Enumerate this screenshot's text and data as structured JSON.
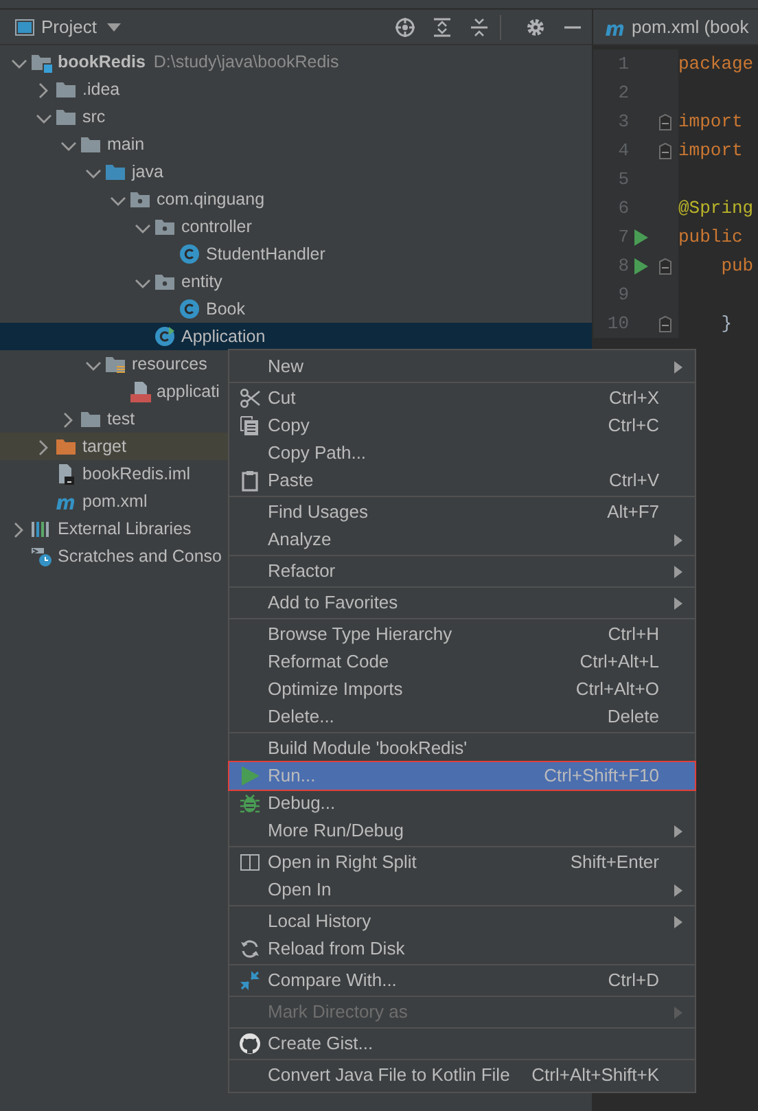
{
  "project_panel": {
    "title": "Project"
  },
  "tree": [
    {
      "label": "bookRedis",
      "path": "D:\\study\\java\\bookRedis",
      "kind": "module",
      "expanded": true,
      "selected": false,
      "children": [
        {
          "label": ".idea",
          "kind": "folder",
          "expanded": false,
          "selected": false
        },
        {
          "label": "src",
          "kind": "folder",
          "expanded": true,
          "selected": false,
          "children": [
            {
              "label": "main",
              "kind": "folder",
              "expanded": true,
              "selected": false,
              "children": [
                {
                  "label": "java",
                  "kind": "source",
                  "expanded": true,
                  "selected": false,
                  "children": [
                    {
                      "label": "com.qinguang",
                      "kind": "package",
                      "expanded": true,
                      "selected": false,
                      "children": [
                        {
                          "label": "controller",
                          "kind": "package",
                          "expanded": true,
                          "selected": false,
                          "children": [
                            {
                              "label": "StudentHandler",
                              "kind": "class",
                              "selected": false
                            }
                          ]
                        },
                        {
                          "label": "entity",
                          "kind": "package",
                          "expanded": true,
                          "selected": false,
                          "children": [
                            {
                              "label": "Book",
                              "kind": "class",
                              "selected": false
                            }
                          ]
                        },
                        {
                          "label": "Application",
                          "kind": "springclass",
                          "selected": true
                        }
                      ]
                    }
                  ]
                },
                {
                  "label": "resources",
                  "kind": "resources",
                  "expanded": true,
                  "selected": false,
                  "children": [
                    {
                      "label": "applicati",
                      "kind": "yml",
                      "selected": false
                    }
                  ]
                }
              ]
            },
            {
              "label": "test",
              "kind": "folder",
              "expanded": false,
              "selected": false
            }
          ]
        },
        {
          "label": "target",
          "kind": "excluded",
          "expanded": false,
          "selected": false
        },
        {
          "label": "bookRedis.iml",
          "kind": "iml",
          "selected": false
        },
        {
          "label": "pom.xml",
          "kind": "maven",
          "selected": false
        }
      ]
    },
    {
      "label": "External Libraries",
      "kind": "libraries",
      "expanded": false,
      "selected": false
    },
    {
      "label": "Scratches and Conso",
      "kind": "scratches",
      "selected": false
    }
  ],
  "editor": {
    "tab": "pom.xml (book",
    "lines": [
      {
        "number": "1",
        "text": "package",
        "kind": "keyword",
        "run_gutter": false,
        "fold": false
      },
      {
        "number": "2",
        "run_gutter": false,
        "fold": false
      },
      {
        "number": "3",
        "text": "import",
        "kind": "keyword",
        "run_gutter": false,
        "fold": true
      },
      {
        "number": "4",
        "text": "import",
        "kind": "keyword",
        "run_gutter": false,
        "fold": true
      },
      {
        "number": "5",
        "run_gutter": false,
        "fold": false
      },
      {
        "number": "6",
        "text": "@Spring",
        "kind": "annotation",
        "run_gutter": false,
        "fold": false
      },
      {
        "number": "7",
        "text": "public",
        "kind": "keyword",
        "run_gutter": true,
        "fold": false
      },
      {
        "number": "8",
        "text": "    pub",
        "kind": "keyword",
        "run_gutter": true,
        "fold": true
      },
      {
        "number": "9",
        "run_gutter": false,
        "fold": false
      },
      {
        "number": "10",
        "text": "    }",
        "kind": "plain",
        "run_gutter": false,
        "fold": true
      }
    ]
  },
  "context_menu": [
    {
      "label": "New",
      "kind": "plain",
      "submenu": true,
      "selected": false,
      "disabled": false
    },
    {
      "label": "Cut",
      "shortcut": "Ctrl+X",
      "kind": "cut",
      "separator_before": true,
      "selected": false,
      "disabled": false
    },
    {
      "label": "Copy",
      "shortcut": "Ctrl+C",
      "kind": "copy",
      "selected": false,
      "disabled": false
    },
    {
      "label": "Copy Path...",
      "kind": "plain",
      "selected": false,
      "disabled": false
    },
    {
      "label": "Paste",
      "shortcut": "Ctrl+V",
      "kind": "paste",
      "selected": false,
      "disabled": false
    },
    {
      "label": "Find Usages",
      "shortcut": "Alt+F7",
      "kind": "plain",
      "separator_before": true,
      "selected": false,
      "disabled": false
    },
    {
      "label": "Analyze",
      "kind": "plain",
      "submenu": true,
      "selected": false,
      "disabled": false
    },
    {
      "label": "Refactor",
      "kind": "plain",
      "submenu": true,
      "separator_before": true,
      "selected": false,
      "disabled": false
    },
    {
      "label": "Add to Favorites",
      "kind": "plain",
      "submenu": true,
      "separator_before": true,
      "selected": false,
      "disabled": false
    },
    {
      "label": "Browse Type Hierarchy",
      "shortcut": "Ctrl+H",
      "kind": "plain",
      "separator_before": true,
      "selected": false,
      "disabled": false
    },
    {
      "label": "Reformat Code",
      "shortcut": "Ctrl+Alt+L",
      "kind": "plain",
      "selected": false,
      "disabled": false
    },
    {
      "label": "Optimize Imports",
      "shortcut": "Ctrl+Alt+O",
      "kind": "plain",
      "selected": false,
      "disabled": false
    },
    {
      "label": "Delete...",
      "shortcut": "Delete",
      "kind": "plain",
      "selected": false,
      "disabled": false
    },
    {
      "label": "Build Module 'bookRedis'",
      "kind": "plain",
      "separator_before": true,
      "selected": false,
      "disabled": false
    },
    {
      "label": "Run...",
      "shortcut": "Ctrl+Shift+F10",
      "kind": "run",
      "selected": true,
      "outlined": true,
      "disabled": false
    },
    {
      "label": "Debug...",
      "kind": "debug",
      "selected": false,
      "disabled": false
    },
    {
      "label": "More Run/Debug",
      "kind": "plain",
      "submenu": true,
      "selected": false,
      "disabled": false
    },
    {
      "label": "Open in Right Split",
      "shortcut": "Shift+Enter",
      "kind": "split",
      "separator_before": true,
      "selected": false,
      "disabled": false
    },
    {
      "label": "Open In",
      "kind": "plain",
      "submenu": true,
      "selected": false,
      "disabled": false
    },
    {
      "label": "Local History",
      "kind": "plain",
      "submenu": true,
      "separator_before": true,
      "selected": false,
      "disabled": false
    },
    {
      "label": "Reload from Disk",
      "kind": "reload",
      "selected": false,
      "disabled": false
    },
    {
      "label": "Compare With...",
      "shortcut": "Ctrl+D",
      "kind": "compare",
      "separator_before": true,
      "selected": false,
      "disabled": false
    },
    {
      "label": "Mark Directory as",
      "kind": "plain",
      "submenu": true,
      "separator_before": true,
      "selected": false,
      "disabled": true
    },
    {
      "label": "Create Gist...",
      "kind": "github",
      "separator_before": true,
      "selected": false,
      "disabled": false
    },
    {
      "label": "Convert Java File to Kotlin File",
      "shortcut": "Ctrl+Alt+Shift+K",
      "kind": "plain",
      "separator_before": true,
      "selected": false,
      "disabled": false
    }
  ]
}
